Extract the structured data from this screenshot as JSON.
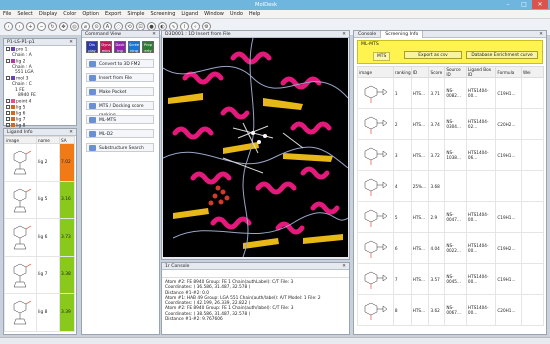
{
  "window": {
    "title": "MolDesk"
  },
  "menu": [
    "File",
    "Select",
    "Display",
    "Color",
    "Option",
    "Export",
    "Simple",
    "Screening",
    "Ligand",
    "Window",
    "Undo",
    "Help"
  ],
  "structure_panel": {
    "title": "P1-LS-P1-p1",
    "tree": [
      {
        "label": "pro 1",
        "color": "#6a42b8",
        "indent": 0,
        "check": true
      },
      {
        "label": "Chain : A",
        "indent": 2
      },
      {
        "label": "lig 2",
        "color": "#b23aa8",
        "indent": 0,
        "check": true
      },
      {
        "label": "Chain : A",
        "indent": 2
      },
      {
        "label": "551 LGA",
        "indent": 3
      },
      {
        "label": "mol 3",
        "color": "#6a42b8",
        "indent": 0,
        "check": true
      },
      {
        "label": "Chain : C",
        "indent": 2
      },
      {
        "label": "1 FE",
        "indent": 3
      },
      {
        "label": "8940 FE",
        "indent": 4
      },
      {
        "label": "point 4",
        "color": "#e8508a",
        "indent": 0,
        "check": true
      },
      {
        "label": "lig 5",
        "color": "#cf6b1f",
        "indent": 0,
        "check": true
      },
      {
        "label": "lig 6",
        "color": "#cf6b1f",
        "indent": 0,
        "check": true
      },
      {
        "label": "lig 7",
        "color": "#cf6b1f",
        "indent": 0,
        "check": true
      },
      {
        "label": "lig 8",
        "color": "#cf6b1f",
        "indent": 0,
        "check": true
      }
    ]
  },
  "ligand_panel": {
    "title": "Ligand Info",
    "columns": [
      "image",
      "name",
      "SA"
    ],
    "rows": [
      {
        "name": "lig 2",
        "sa": "7.02",
        "color": "#f07b16"
      },
      {
        "name": "lig 5",
        "sa": "3.16",
        "color": "#88c91c"
      },
      {
        "name": "lig 6",
        "sa": "3.73",
        "color": "#88c91c"
      },
      {
        "name": "lig 7",
        "sa": "3.38",
        "color": "#88c91c"
      },
      {
        "name": "lig 8",
        "sa": "3.39",
        "color": "#88c91c"
      }
    ]
  },
  "command_view": {
    "title": "Command View",
    "toggles": [
      {
        "label": "Dis play",
        "color": "#2c39a8"
      },
      {
        "label": "Dyna mics",
        "color": "#c2185b"
      },
      {
        "label": "Dock ing",
        "color": "#8e24aa"
      },
      {
        "label": "Scree ning",
        "color": "#1976d2"
      },
      {
        "label": "Prop erty",
        "color": "#2e7d32"
      }
    ],
    "buttons": [
      "Convert to 3D FM2",
      "Insert from File",
      "Make Pocket",
      "MTS / Docking score ranking",
      "ML-MTS",
      "ML-D2",
      "Substructure Search"
    ]
  },
  "viewer": {
    "title": "D3D001 : 1D Insert from File"
  },
  "console_bottom": {
    "title": "1r Console",
    "lines": [
      "Atom #2: FE 8940 Group: FE 1 Chain(authLabel): C/T File: 3",
      "   Coordinates: ( 36.586, 31.487, 32.578 )",
      "Distance #1-#2: 0.0",
      "Atom #1: HAB 49 Group: LGA 551 Chain(auth/label): A/T Model: 1 File: 2",
      "   Coordinates: ( 42.199, 26.339, 22.822 )",
      "Atom #2: FE 8940 Group: FE 1 Chain(auth/label): C/T File: 3",
      "   Coordinates: ( 38.586, 31.487, 32.578 )",
      "Distance #1-#2: 9.767606"
    ]
  },
  "right_tabs": [
    {
      "label": "Console"
    },
    {
      "label": "Screening Info"
    }
  ],
  "screening": {
    "name": "ML-MTS",
    "tab": "MTS",
    "buttons": [
      "Export as csv",
      "Database Enrichment curve"
    ],
    "columns": [
      "image",
      "ranking",
      "ID",
      "Score",
      "Source ID",
      "Ligand Box ID",
      "Formula",
      "Wei"
    ],
    "rows": [
      {
        "ranking": "1",
        "id": "HTS...",
        "score": "3.71",
        "source": "NS-0082...",
        "ligand": "HTS1404-00...",
        "formula": "C19H1..."
      },
      {
        "ranking": "2",
        "id": "HTS...",
        "score": "3.74",
        "source": "NS-0304...",
        "ligand": "HTS1404-02...",
        "formula": "C20H2..."
      },
      {
        "ranking": "3",
        "id": "HTS...",
        "score": "3.72",
        "source": "NS-1038...",
        "ligand": "HTS1404-06...",
        "formula": "C19H1..."
      },
      {
        "ranking": "4",
        "id": "25%...",
        "score": "3.68",
        "source": "",
        "ligand": "",
        "formula": ""
      },
      {
        "ranking": "5",
        "id": "HTS...",
        "score": "2.9",
        "source": "NS-0047...",
        "ligand": "HTS1404-00...",
        "formula": "C19H1..."
      },
      {
        "ranking": "6",
        "id": "HTS...",
        "score": "4.04",
        "source": "NS-0022...",
        "ligand": "HTS1404-00...",
        "formula": "C19H2..."
      },
      {
        "ranking": "7",
        "id": "HTS...",
        "score": "3.57",
        "source": "NS-0045...",
        "ligand": "HTS1404-00...",
        "formula": "C19H1..."
      },
      {
        "ranking": "8",
        "id": "HTS...",
        "score": "3.62",
        "source": "NS-0067...",
        "ligand": "HTS1404-00...",
        "formula": "C20H1..."
      }
    ]
  },
  "colors": {
    "title_bar": "#6fb6de",
    "selected": "#fff44f",
    "ribbon_pink": "#e5197c",
    "ribbon_gold": "#e8b818"
  }
}
